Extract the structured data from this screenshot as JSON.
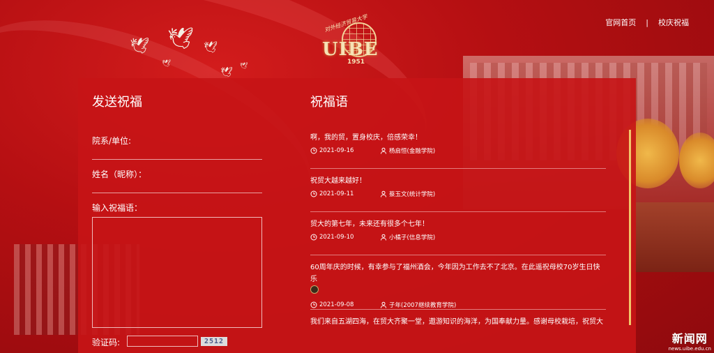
{
  "nav": {
    "home_label": "官网首页",
    "separator": "|",
    "celebration_label": "校庆祝福"
  },
  "logo": {
    "abbr": "UIBE",
    "year": "1951",
    "arc_text": "对外经济贸易大学"
  },
  "send_form": {
    "title": "发送祝福",
    "department_label": "院系/单位:",
    "name_label": "姓名（昵称）：",
    "message_label": "输入祝福语：",
    "captcha_label": "验证码:",
    "captcha_code": "2512"
  },
  "wishes_section": {
    "title": "祝福语",
    "items": [
      {
        "text": "啊，我的贸，置身校庆，倍感荣幸！",
        "date": "2021-09-16",
        "author": "杨启恒(金融学院)"
      },
      {
        "text": "祝贸大越来越好！",
        "date": "2021-09-11",
        "author": "蔡玉文(统计学院)"
      },
      {
        "text": "贸大的第七年，未来还有很多个七年！",
        "date": "2021-09-10",
        "author": "小橘子(信息学院)"
      },
      {
        "text": "60周年庆的时候，有幸参与了福州酒会，今年因为工作去不了北京。在此遥祝母校70岁生日快乐",
        "date": "2021-09-08",
        "author": "子年(2007继续教育学院)"
      },
      {
        "text": "我们来自五湖四海，在贸大齐聚一堂，遨游知识的海洋，为国奉献力量。感谢母校栽培，祝贸大",
        "date": "",
        "author": ""
      }
    ]
  },
  "watermark": {
    "name": "新闻网",
    "url": "news.uibe.edu.cn"
  },
  "icons": {
    "clock": "clock-icon",
    "user": "user-icon"
  },
  "colors": {
    "panel": "#c61416",
    "accent_gold": "#f2c66a"
  }
}
